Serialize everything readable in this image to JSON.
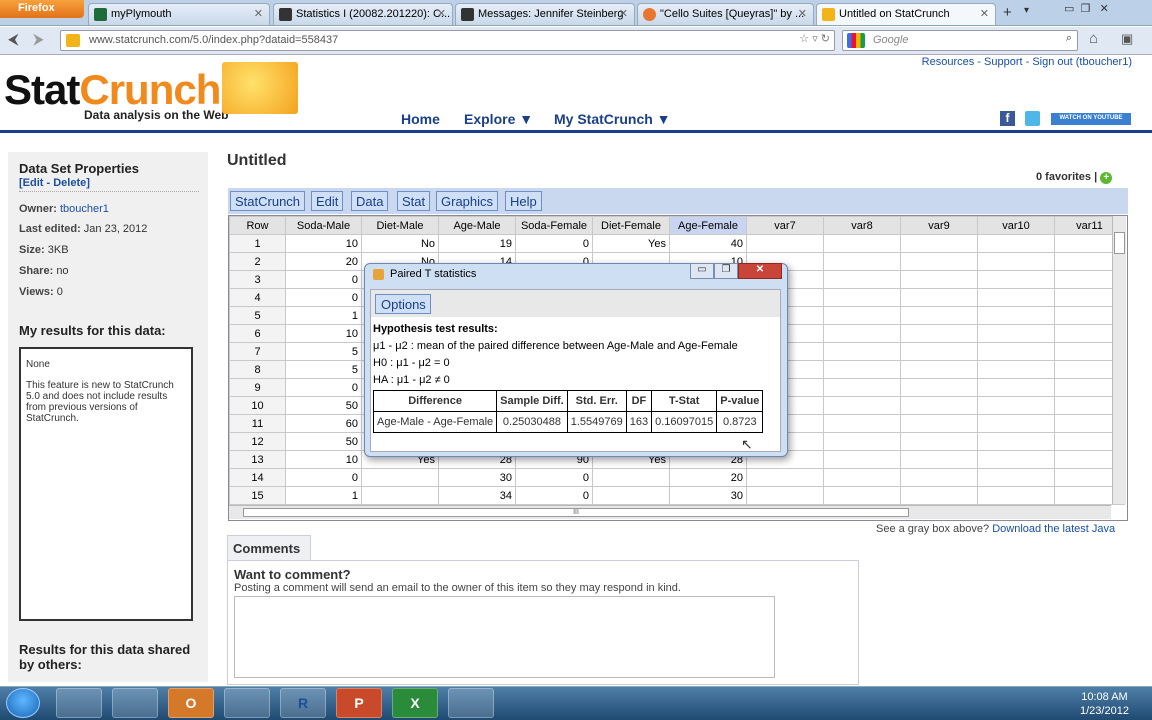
{
  "browser": {
    "menu_label": "Firefox",
    "tabs": [
      {
        "label": "myPlymouth",
        "color": "#1f6b3a"
      },
      {
        "label": "Statistics I (20082.201220): C...",
        "color": "#333333"
      },
      {
        "label": "Messages: Jennifer Steinberg",
        "color": "#333333"
      },
      {
        "label": "\"Cello Suites [Queyras]\" by ...",
        "color": "#e8762e"
      },
      {
        "label": "Untitled on StatCrunch",
        "color": "#f2b418"
      }
    ],
    "new_tab": "+",
    "url": "www.statcrunch.com/5.0/index.php?dataid=558437",
    "search_placeholder": "Google"
  },
  "site": {
    "logo": {
      "stat": "Stat",
      "crunch": "Crunch",
      "tagline": "Data analysis on the Web"
    },
    "top_links": "Resources - Support - Sign out (tboucher1)",
    "nav": [
      "Home",
      "Explore ▼",
      "My StatCrunch ▼"
    ],
    "youtube": "WATCH ON YOUTUBE"
  },
  "sidebar": {
    "heading": "Data Set Properties",
    "edit_delete": "[Edit - Delete]",
    "owner_label": "Owner:",
    "owner": "tboucher1",
    "edited_label": "Last edited:",
    "edited": "Jan 23, 2012",
    "size_label": "Size:",
    "size": "3KB",
    "share_label": "Share:",
    "share": "no",
    "views_label": "Views:",
    "views": "0",
    "results_heading": "My results for this data:",
    "results_none": "None",
    "results_note": "This feature is new to StatCrunch 5.0 and does not include results from previous versions of StatCrunch.",
    "others_heading": "Results for this data shared by others:"
  },
  "dataset": {
    "title": "Untitled",
    "favorites": "0 favorites |",
    "menu": [
      "StatCrunch",
      "Edit",
      "Data",
      "Stat",
      "Graphics",
      "Help"
    ],
    "columns": [
      "Row",
      "Soda-Male",
      "Diet-Male",
      "Age-Male",
      "Soda-Female",
      "Diet-Female",
      "Age-Female",
      "var7",
      "var8",
      "var9",
      "var10",
      "var11"
    ],
    "rows": [
      [
        "1",
        "10",
        "No",
        "19",
        "0",
        "Yes",
        "40"
      ],
      [
        "2",
        "20",
        "No",
        "14",
        "0",
        "",
        "10"
      ],
      [
        "3",
        "0",
        "",
        "",
        "",
        "",
        ""
      ],
      [
        "4",
        "0",
        "",
        "",
        "",
        "",
        ""
      ],
      [
        "5",
        "1",
        "",
        "",
        "",
        "",
        ""
      ],
      [
        "6",
        "10",
        "",
        "",
        "",
        "",
        ""
      ],
      [
        "7",
        "5",
        "",
        "",
        "",
        "",
        ""
      ],
      [
        "8",
        "5",
        "",
        "",
        "",
        "",
        ""
      ],
      [
        "9",
        "0",
        "",
        "",
        "",
        "",
        ""
      ],
      [
        "10",
        "50",
        "",
        "",
        "",
        "",
        ""
      ],
      [
        "11",
        "60",
        "",
        "",
        "",
        "",
        ""
      ],
      [
        "12",
        "50",
        "",
        "",
        "",
        "",
        ""
      ],
      [
        "13",
        "10",
        "Yes",
        "28",
        "90",
        "Yes",
        "28"
      ],
      [
        "14",
        "0",
        "",
        "30",
        "0",
        "",
        "20"
      ],
      [
        "15",
        "1",
        "",
        "34",
        "0",
        "",
        "30"
      ]
    ],
    "scroll_grip": "III",
    "java_note": "See a gray box above?",
    "java_link": "Download the latest Java"
  },
  "comments": {
    "tab": "Comments",
    "heading": "Want to comment?",
    "note": "Posting a comment will send an email to the owner of this item so they may respond in kind."
  },
  "dialog": {
    "title": "Paired T statistics",
    "options": "Options",
    "heading": "Hypothesis test results:",
    "line_mu": "μ1 - μ2 : mean of the paired difference between Age-Male and Age-Female",
    "line_h0": "H0 : μ1 - μ2 = 0",
    "line_ha": "HA : μ1 - μ2 ≠ 0",
    "table_headers": [
      "Difference",
      "Sample Diff.",
      "Std. Err.",
      "DF",
      "T-Stat",
      "P-value"
    ],
    "table_row": [
      "Age-Male - Age-Female",
      "0.25030488",
      "1.5549769",
      "163",
      "0.16097015",
      "0.8723"
    ]
  },
  "taskbar": {
    "apps": [
      "",
      "",
      "O",
      "",
      "R",
      "P",
      "X",
      ""
    ],
    "time": "10:08 AM",
    "date": "1/23/2012"
  }
}
